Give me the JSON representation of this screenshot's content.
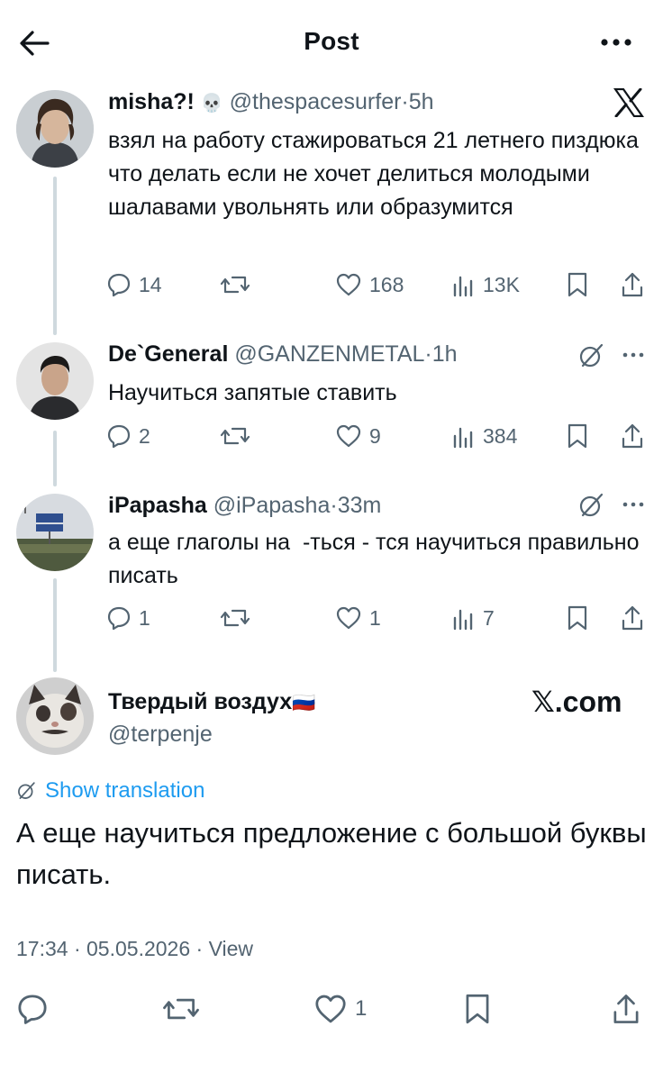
{
  "header": {
    "title": "Post",
    "back_icon": "arrow-left-icon",
    "more_icon": "more-dots-icon"
  },
  "thread": [
    {
      "display_name": "misha?!",
      "name_emoji": "💀",
      "handle": "@thespacesurfer",
      "time": "5h",
      "text": "взял на работу стажироваться 21 летнего пиздюка что делать если не хочет делиться молодыми шалавами увольнять или образумится",
      "corner_icon": "x-logo-icon",
      "replies": "14",
      "reposts": "",
      "likes": "168",
      "views": "13K"
    },
    {
      "display_name": "De`General",
      "handle": "@GANZENMETAL",
      "time": "1h",
      "text": "Научиться запятые ставить",
      "corner_icon": "grok-icon",
      "replies": "2",
      "reposts": "",
      "likes": "9",
      "views": "384"
    },
    {
      "display_name": "iPapasha",
      "handle": "@iPapasha",
      "time": "33m",
      "text": "а еще глаголы на  -ться - тся научиться правильно писать",
      "corner_icon": "grok-icon",
      "replies": "1",
      "reposts": "",
      "likes": "1",
      "views": "7"
    }
  ],
  "main_post": {
    "display_name": "Твердый воздух",
    "name_flag": "🇷🇺",
    "handle": "@terpenje",
    "watermark": "𝕏.com",
    "translate_label": "Show translation",
    "text": "А еще научиться предложение с большой буквы писать.",
    "time": "17:34",
    "date": "05.05.2026",
    "views_label": "View",
    "replies": "",
    "reposts": "",
    "likes": "1"
  },
  "separator": "·",
  "colors": {
    "text": "#0f1419",
    "secondary": "#536471",
    "link": "#1d9bf0",
    "thread_line": "#cfd9de"
  }
}
